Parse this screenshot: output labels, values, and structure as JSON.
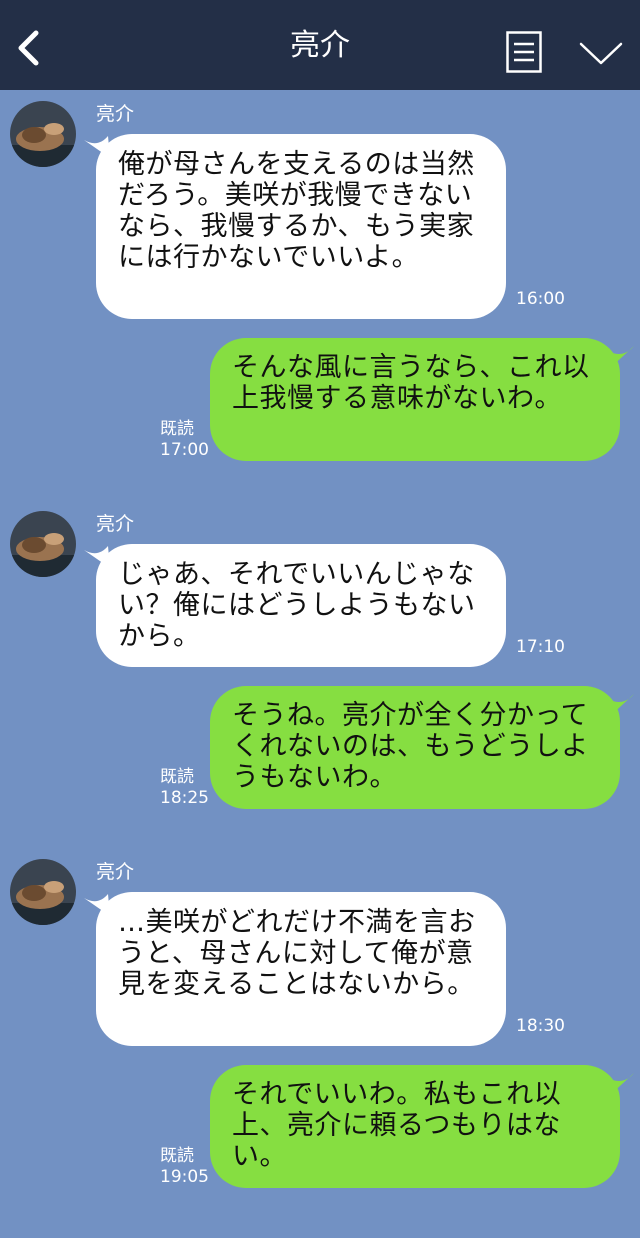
{
  "header": {
    "title": "亮介",
    "back_icon": "chevron-left-icon",
    "menu_icon": "notes-icon",
    "expand_icon": "chevron-down-icon",
    "background": "#232f47"
  },
  "colors": {
    "chat_background": "#7291c3",
    "incoming_bubble": "#ffffff",
    "outgoing_bubble": "#86de41"
  },
  "messages": [
    {
      "sender": "亮介",
      "text": "俺が母さんを支えるのは当然だろう。美咲が我慢できないなら、我慢するか、もう実家には行かないでいいよ。",
      "time": "16:00"
    },
    {
      "text": "そんな風に言うなら、これ以上我慢する意味がないわ。",
      "read": "既読",
      "time": "17:00"
    },
    {
      "sender": "亮介",
      "text": "じゃあ、それでいいんじゃない？俺にはどうしようもないから。",
      "time": "17:10"
    },
    {
      "text": "そうね。亮介が全く分かってくれないのは、もうどうしようもないわ。",
      "read": "既読",
      "time": "18:25"
    },
    {
      "sender": "亮介",
      "text": "…美咲がどれだけ不満を言おうと、母さんに対して俺が意見を変えることはないから。",
      "time": "18:30"
    },
    {
      "text": "それでいいわ。私もこれ以上、亮介に頼るつもりはない。",
      "read": "既読",
      "time": "19:05"
    }
  ]
}
